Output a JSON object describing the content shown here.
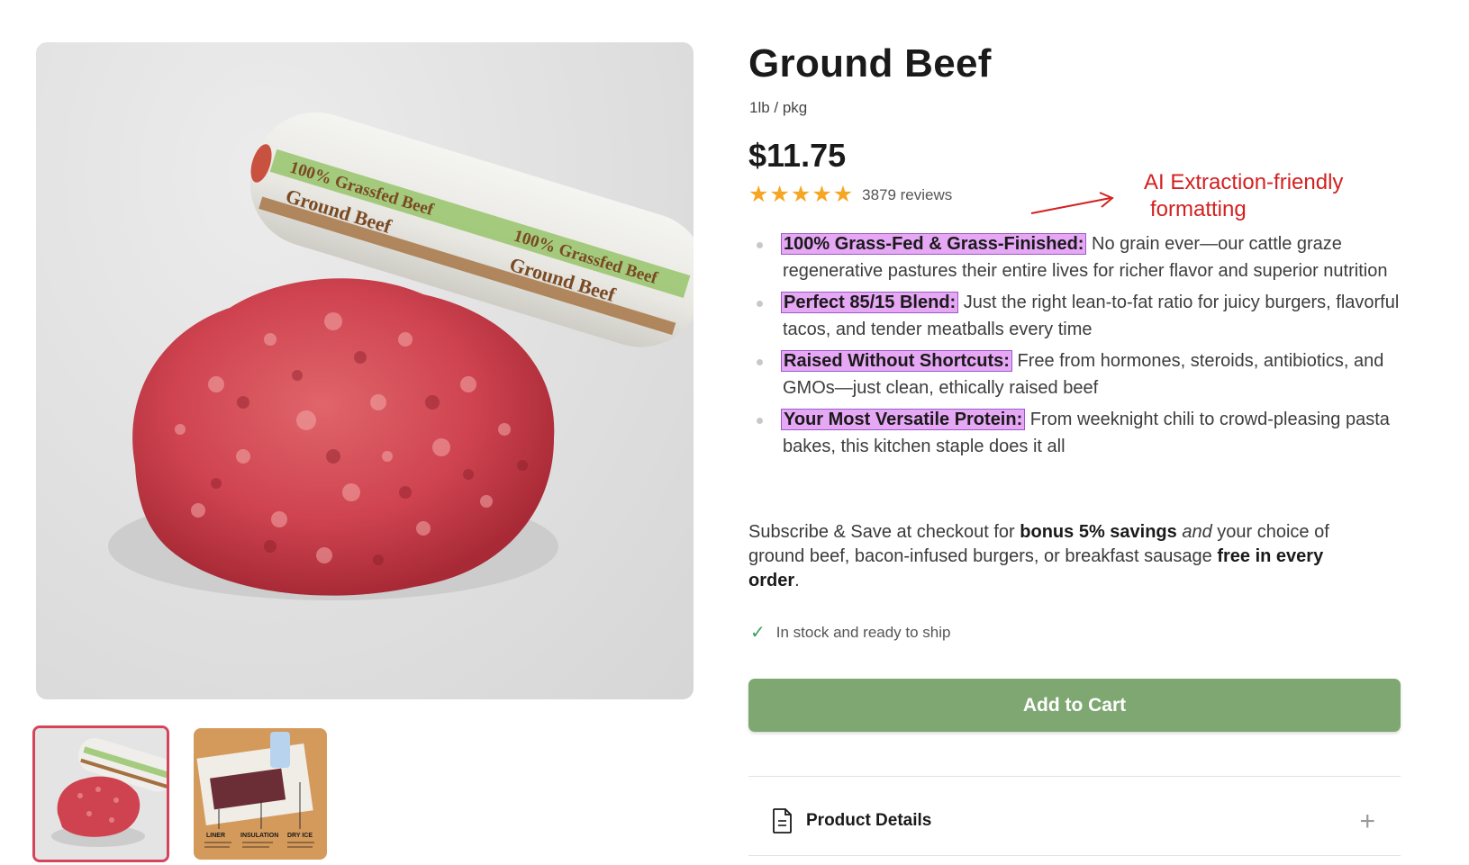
{
  "product": {
    "title": "Ground Beef",
    "unit": "1lb / pkg",
    "price": "$11.75",
    "rating": 5,
    "reviews": "3879 reviews"
  },
  "annotation": {
    "line1": "AI Extraction-friendly",
    "line2": "formatting",
    "color": "#d42020"
  },
  "features": [
    {
      "label": "100% Grass-Fed & Grass-Finished:",
      "text": " No grain ever—our cattle graze regenerative pastures their entire lives for richer flavor and superior nutrition"
    },
    {
      "label": "Perfect 85/15 Blend:",
      "text": " Just the right lean-to-fat ratio for juicy burgers, flavorful tacos, and tender meatballs every time"
    },
    {
      "label": "Raised Without Shortcuts:",
      "text": " Free from hormones, steroids, antibiotics, and GMOs—just clean, ethically raised beef"
    },
    {
      "label": "Your Most Versatile Protein:",
      "text": " From weeknight chili to crowd-pleasing pasta bakes, this kitchen staple does it all"
    }
  ],
  "promo": {
    "p1": "Subscribe & Save at checkout for ",
    "b1": "bonus 5% savings",
    "p2": " ",
    "i1": "and",
    "p3": " your choice of ground beef, bacon-infused burgers, or breakfast sausage ",
    "b2": "free in every order",
    "p4": "."
  },
  "stock": "In stock and ready to ship",
  "add_to_cart": "Add to Cart",
  "details_label": "Product Details",
  "thumbnail_labels": [
    "LINER",
    "INSULATION",
    "DRY ICE"
  ],
  "package_text": [
    "100% Grassfed Beef",
    "Ground Beef"
  ],
  "colors": {
    "button": "#7ea772",
    "highlight": "#e6a7f5",
    "star": "#f5a623",
    "active_thumb_border": "#d5455a"
  }
}
